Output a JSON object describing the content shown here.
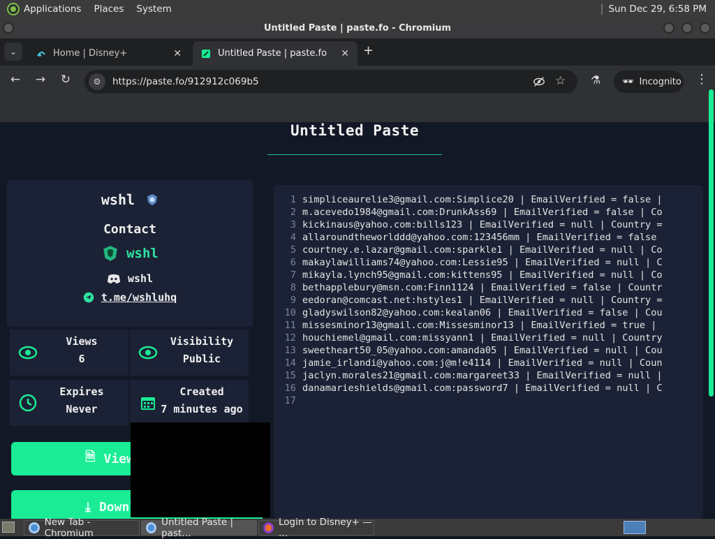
{
  "panel": {
    "menus": [
      "Applications",
      "Places",
      "System"
    ],
    "clock": "Sun Dec 29,  6:58 PM"
  },
  "window": {
    "title": "Untitled Paste | paste.fo - Chromium"
  },
  "tabs": [
    {
      "label": "Home | Disney+"
    },
    {
      "label": "Untitled Paste | paste.fo"
    }
  ],
  "omnibox": {
    "url": "https://paste.fo/912912c069b5"
  },
  "incognito_label": "Incognito",
  "paste": {
    "title": "Untitled Paste",
    "author": "wshl",
    "contact_heading": "Contact",
    "brand": "wshl",
    "discord": "wshl",
    "telegram": "t.me/wshluhq",
    "stats": {
      "views_label": "Views",
      "views_value": "6",
      "visibility_label": "Visibility",
      "visibility_value": "Public",
      "expires_label": "Expires",
      "expires_value": "Never",
      "created_label": "Created",
      "created_value": "7 minutes ago"
    },
    "buttons": {
      "view": "View",
      "download": "Download"
    },
    "lines": [
      "simpliceaurelie3@gmail.com:Simplice20 | EmailVerified = false |",
      "m.acevedo1984@gmail.com:DrunkAss69 | EmailVerified = false | Co",
      "kickinaus@yahoo.com:bills123 | EmailVerified = null | Country =",
      "allaroundtheworlddd@yahoo.com:123456mm | EmailVerified = false",
      "courtney.e.lazar@gmail.com:sparkle1 | EmailVerified = null | Co",
      "makaylawilliams74@yahoo.com:Lessie95 | EmailVerified = null | C",
      "mikayla.lynch95@gmail.com:kittens95 | EmailVerified = null | Co",
      "bethapplebury@msn.com:Finn1124 | EmailVerified = false | Countr",
      "eedoran@comcast.net:hstyles1 | EmailVerified = null | Country =",
      "gladyswilson82@yahoo.com:kealan06 | EmailVerified = false | Cou",
      "missesminor13@gmail.com:Missesminor13 | EmailVerified = true |",
      "houchiemel@gmail.com:missyann1 | EmailVerified = null | Country",
      "sweetheart50_05@yahoo.com:amanda05 | EmailVerified = null | Cou",
      "jamie_irlandi@yahoo.com:j@m!e4114 | EmailVerified = null | Coun",
      "jaclyn.morales21@gmail.com:margareet33 | EmailVerified = null |",
      "danamarieshields@gmail.com:password7 | EmailVerified = null | C",
      ""
    ]
  },
  "taskbar": [
    {
      "label": "New Tab - Chromium"
    },
    {
      "label": "Untitled Paste | past..."
    },
    {
      "label": "Login to Disney+ — ..."
    }
  ],
  "colors": {
    "accent": "#19ec95",
    "brand_green": "#2de3a0",
    "page_bg": "#131826",
    "card_bg": "#1c2235"
  }
}
